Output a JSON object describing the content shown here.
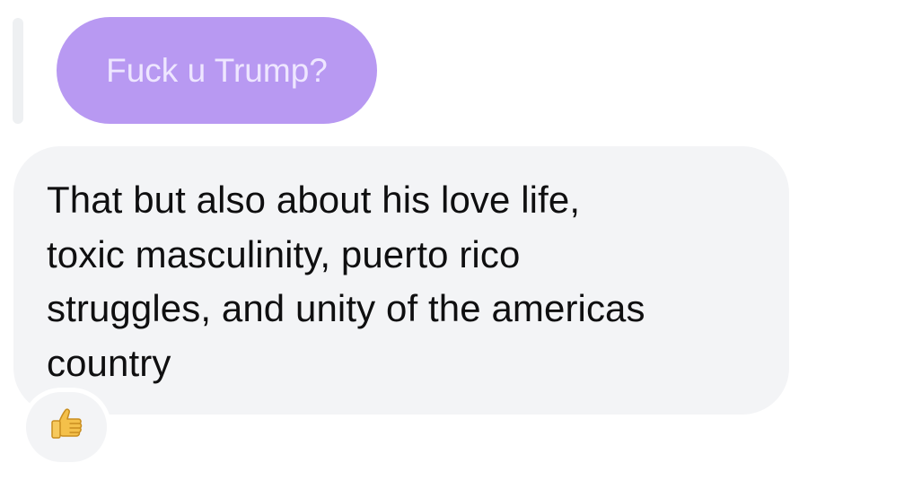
{
  "reply": {
    "quoted_text": "Fuck u Trump?",
    "bubble_color": "#b899f2"
  },
  "message": {
    "lines": [
      "That but also about his love life,",
      "toxic masculinity, puerto rico",
      "struggles, and unity of the americas",
      "country"
    ],
    "bubble_color": "#f3f4f6"
  },
  "reaction": {
    "icon": "thumbs-up-icon",
    "color": "#f4c04a"
  }
}
